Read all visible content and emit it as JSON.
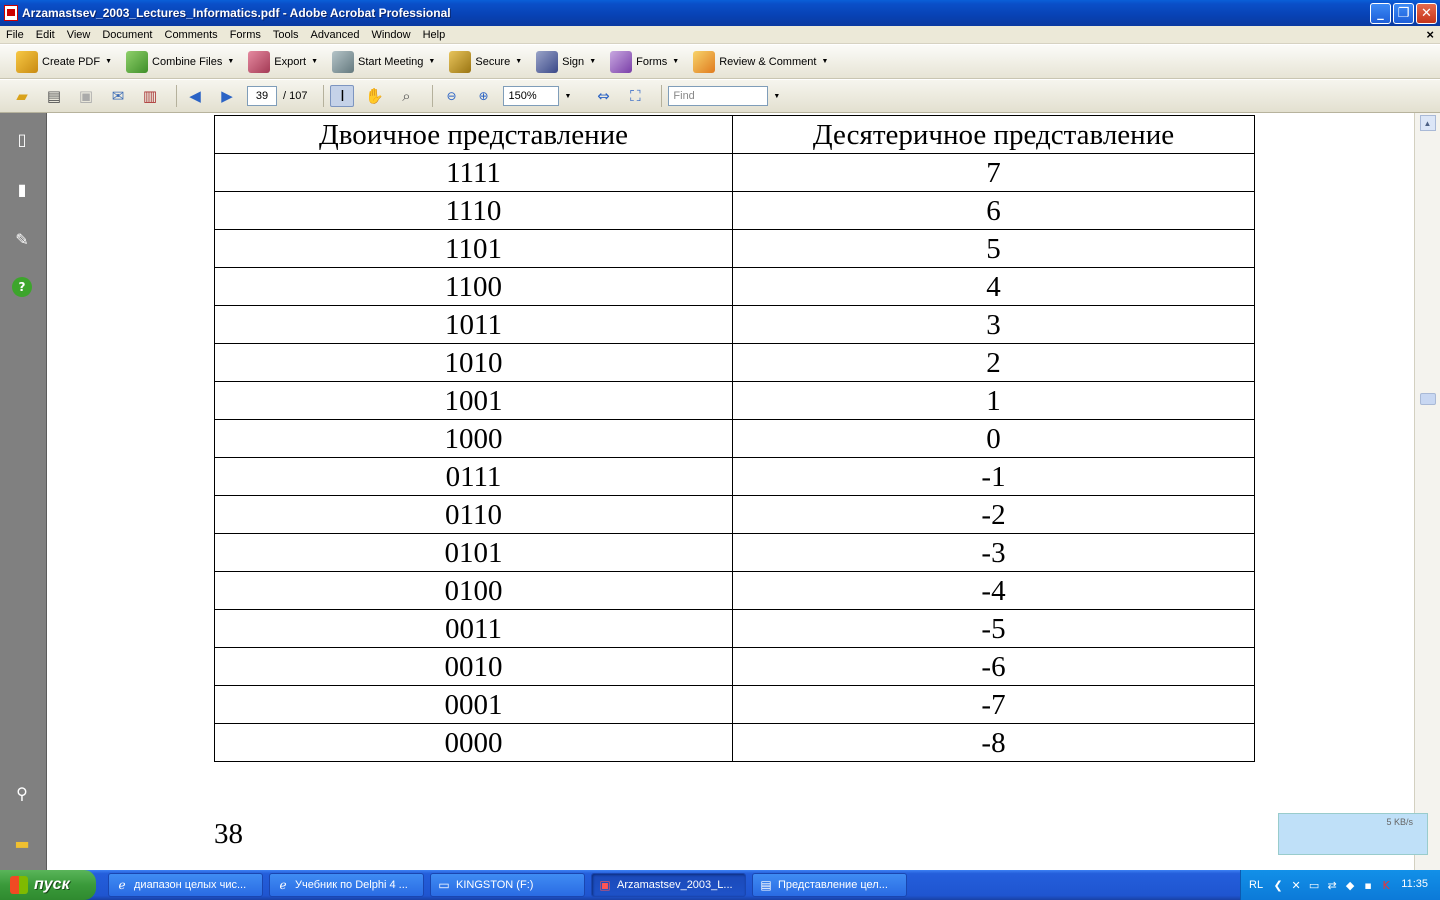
{
  "window": {
    "title": "Arzamastsev_2003_Lectures_Informatics.pdf - Adobe Acrobat Professional",
    "minimize": "_",
    "maximize": "❐",
    "close": "✕"
  },
  "menu": {
    "items": [
      "File",
      "Edit",
      "View",
      "Document",
      "Comments",
      "Forms",
      "Tools",
      "Advanced",
      "Window",
      "Help"
    ],
    "close": "×"
  },
  "toolbar1": {
    "create_pdf": "Create PDF",
    "combine_files": "Combine Files",
    "export": "Export",
    "start_meeting": "Start Meeting",
    "secure": "Secure",
    "sign": "Sign",
    "forms": "Forms",
    "review_comment": "Review & Comment"
  },
  "toolbar2": {
    "current_page": "39",
    "total_pages": "/ 107",
    "zoom": "150%",
    "find_placeholder": "Find"
  },
  "table": {
    "headers": [
      "Двоичное представление",
      "Десятеричное представление"
    ],
    "rows": [
      [
        "1111",
        "7"
      ],
      [
        "1110",
        "6"
      ],
      [
        "1101",
        "5"
      ],
      [
        "1100",
        "4"
      ],
      [
        "1011",
        "3"
      ],
      [
        "1010",
        "2"
      ],
      [
        "1001",
        "1"
      ],
      [
        "1000",
        "0"
      ],
      [
        "0111",
        "-1"
      ],
      [
        "0110",
        "-2"
      ],
      [
        "0101",
        "-3"
      ],
      [
        "0100",
        "-4"
      ],
      [
        "0011",
        "-5"
      ],
      [
        "0010",
        "-6"
      ],
      [
        "0001",
        "-7"
      ],
      [
        "0000",
        "-8"
      ]
    ]
  },
  "page_number": "38",
  "download": {
    "speed": "5 KB/s"
  },
  "taskbar": {
    "start": "пуск",
    "tasks": [
      {
        "label": "диапазон целых чис...",
        "active": false
      },
      {
        "label": "Учебник по Delphi 4 ...",
        "active": false
      },
      {
        "label": "KINGSTON (F:)",
        "active": false
      },
      {
        "label": "Arzamastsev_2003_L...",
        "active": true
      },
      {
        "label": "Представление цел...",
        "active": false
      }
    ],
    "lang": "RL",
    "clock": "11:35"
  },
  "colors": {
    "titlebar": "#0842b4",
    "taskbar": "#245edb",
    "start": "#3a9a3a",
    "leftnav": "#808080"
  }
}
